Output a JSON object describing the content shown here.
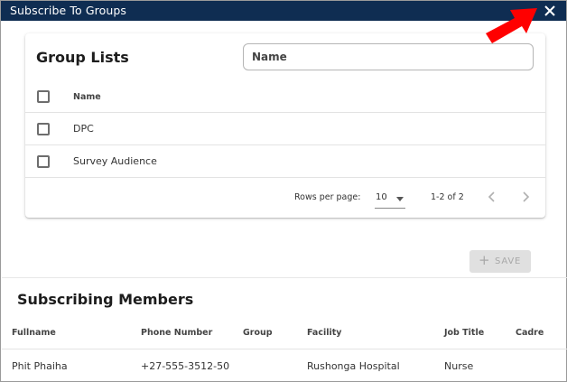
{
  "dialog": {
    "title": "Subscribe To Groups",
    "close_icon": "close-icon"
  },
  "annotation": {
    "arrow_color": "#ff0000",
    "arrow_icon": "red-arrow-pointer-icon"
  },
  "group_lists": {
    "title": "Group Lists",
    "search": {
      "placeholder": "Name",
      "value": ""
    },
    "columns": [
      "Name"
    ],
    "rows": [
      {
        "name": "DPC",
        "checked": false
      },
      {
        "name": "Survey Audience",
        "checked": false
      }
    ],
    "pagination": {
      "rows_per_page_label": "Rows per page:",
      "rows_per_page_value": "10",
      "range": "1-2 of 2",
      "prev_icon": "chevron-left-icon",
      "next_icon": "chevron-right-icon"
    }
  },
  "save_button": {
    "label": "SAVE",
    "icon": "plus-icon",
    "disabled": true
  },
  "subscribing_members": {
    "title": "Subscribing Members",
    "columns": [
      "Fullname",
      "Phone Number",
      "Group",
      "Facility",
      "Job Title",
      "Cadre"
    ],
    "rows": [
      [
        "Phit Phaiha",
        "+27-555-3512-50",
        "",
        "Rushonga Hospital",
        "Nurse",
        ""
      ]
    ]
  },
  "colors": {
    "titlebar": "#0f2d52",
    "arrow": "#ff0000",
    "save_disabled_bg": "#e0e0e0"
  }
}
